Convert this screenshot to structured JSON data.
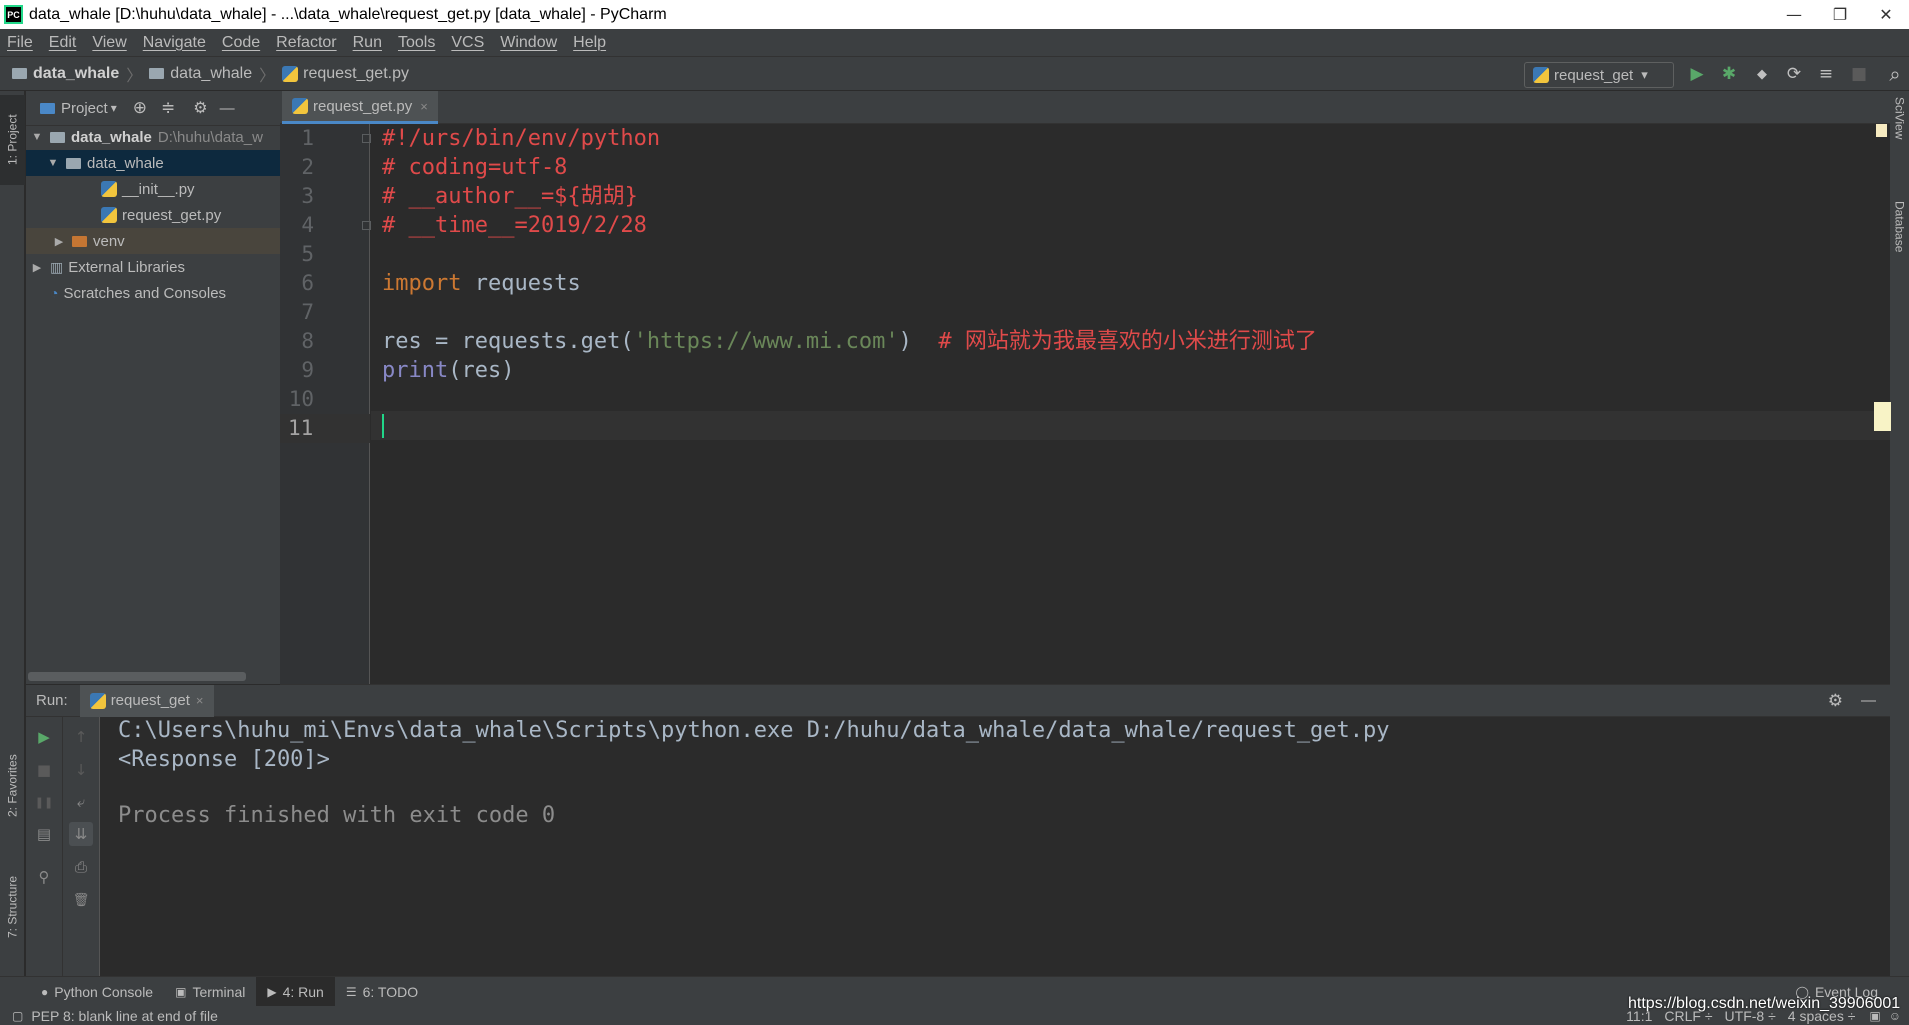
{
  "window": {
    "title": "data_whale [D:\\huhu\\data_whale] - ...\\data_whale\\request_get.py [data_whale] - PyCharm",
    "app_icon_text": "PC",
    "minimize": "—",
    "restore": "❐",
    "close": "✕"
  },
  "menu": [
    "File",
    "Edit",
    "View",
    "Navigate",
    "Code",
    "Refactor",
    "Run",
    "Tools",
    "VCS",
    "Window",
    "Help"
  ],
  "breadcrumb": {
    "project": "data_whale",
    "folder": "data_whale",
    "file": "request_get.py"
  },
  "run_config": {
    "name": "request_get",
    "dropdown_glyph": "▾"
  },
  "toolbar_glyphs": {
    "run": "▶",
    "debug": "✱",
    "coverage": "◆",
    "profile": "⟳",
    "concurrency": "≡",
    "stop": "■",
    "search": "⌕"
  },
  "left_tabs": {
    "project": "1: Project",
    "favorites": "2: Favorites",
    "structure": "7: Structure"
  },
  "right_tabs": {
    "sciview": "SciView",
    "database": "Database"
  },
  "project_panel": {
    "title": "Project",
    "dropdown": "▾",
    "icons": {
      "locate": "⊕",
      "collapse": "≑",
      "settings": "⚙",
      "hide": "—"
    },
    "tree": [
      {
        "label": "data_whale",
        "suffix": "D:\\huhu\\data_w",
        "arrow": "▼"
      },
      {
        "label": "data_whale",
        "arrow": "▼"
      },
      {
        "label": "__init__.py"
      },
      {
        "label": "request_get.py"
      },
      {
        "label": "venv",
        "arrow": "▶"
      },
      {
        "label": "External Libraries",
        "arrow": "▶"
      },
      {
        "label": "Scratches and Consoles"
      }
    ]
  },
  "editor": {
    "tab": "request_get.py",
    "tab_close": "×",
    "line_numbers": [
      "1",
      "2",
      "3",
      "4",
      "5",
      "6",
      "7",
      "8",
      "9",
      "10",
      "11"
    ],
    "lines": {
      "l1": "#!/urs/bin/env/python",
      "l2": "# coding=utf-8",
      "l3": "# __author__=${胡胡}",
      "l4": "# __time__=2019/2/28",
      "l6_kw": "import",
      "l6_rest": " requests",
      "l8_a": "res = requests.get(",
      "l8_str": "'https://www.mi.com'",
      "l8_b": ")  ",
      "l8_comment": "# 网站就为我最喜欢的小米进行测试了",
      "l9_fn": "print",
      "l9_rest": "(res)"
    }
  },
  "run_panel": {
    "label": "Run:",
    "tab": "request_get",
    "tab_close": "×",
    "settings": "⚙",
    "hide": "—",
    "output": [
      "C:\\Users\\huhu_mi\\Envs\\data_whale\\Scripts\\python.exe D:/huhu/data_whale/data_whale/request_get.py",
      "<Response [200]>",
      "Process finished with exit code 0"
    ],
    "icons1": [
      "▶",
      "■",
      "❚❚",
      "▤",
      "⚲"
    ],
    "icons2": [
      "↑",
      "↓",
      "⤶",
      "⇊",
      "⎙",
      "🗑"
    ]
  },
  "bottom_tools": [
    {
      "icon": "●",
      "label": "Python Console"
    },
    {
      "icon": "▣",
      "label": "Terminal"
    },
    {
      "icon": "▶",
      "label": "4: Run"
    },
    {
      "icon": "☰",
      "label": "6: TODO"
    }
  ],
  "event_log": "Event Log",
  "status": {
    "message": "PEP 8: blank line at end of file",
    "position": "11:1",
    "line_sep": "CRLF ÷",
    "encoding": "UTF-8 ÷",
    "indent": "4 spaces ÷"
  },
  "watermark": "https://blog.csdn.net/weixin_39906001"
}
